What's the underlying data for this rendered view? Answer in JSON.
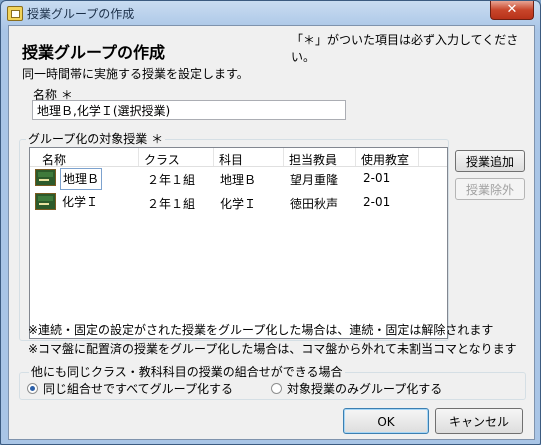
{
  "window": {
    "title": "授業グループの作成",
    "close_glyph": "✕"
  },
  "header": {
    "heading": "授業グループの作成",
    "required_note": "「＊」がついた項目は必ず入力してください。",
    "subtitle": "同一時間帯に実施する授業を設定します。"
  },
  "name_field": {
    "label": "名称 ＊",
    "value": "地理Ｂ,化学Ｉ(選択授業)"
  },
  "lessons": {
    "group_title": "グループ化の対象授業 ＊",
    "columns": [
      "名称",
      "クラス",
      "科目",
      "担当教員",
      "使用教室"
    ],
    "rows": [
      {
        "name": "地理Ｂ",
        "class": "２年１組",
        "subject": "地理Ｂ",
        "teacher": "望月重隆",
        "room": "2-01"
      },
      {
        "name": "化学Ｉ",
        "class": "２年１組",
        "subject": "化学Ｉ",
        "teacher": "徳田秋声",
        "room": "2-01"
      }
    ],
    "add_label": "授業追加",
    "remove_label": "授業除外"
  },
  "notes": {
    "note1": "※連続・固定の設定がされた授業をグループ化した場合は、連続・固定は解除されます",
    "note2": "※コマ盤に配置済の授業をグループ化した場合は、コマ盤から外れて未割当コマとなります"
  },
  "options": {
    "title": "他にも同じクラス・教科科目の授業の組合せができる場合",
    "choices": [
      "同じ組合せですべてグループ化する",
      "対象授業のみグループ化する"
    ],
    "selected": 0
  },
  "footer": {
    "ok_label": "OK",
    "cancel_label": "キャンセル"
  },
  "icons": {
    "row_icon": "chalkboard-icon",
    "app_icon": "window-icon"
  }
}
